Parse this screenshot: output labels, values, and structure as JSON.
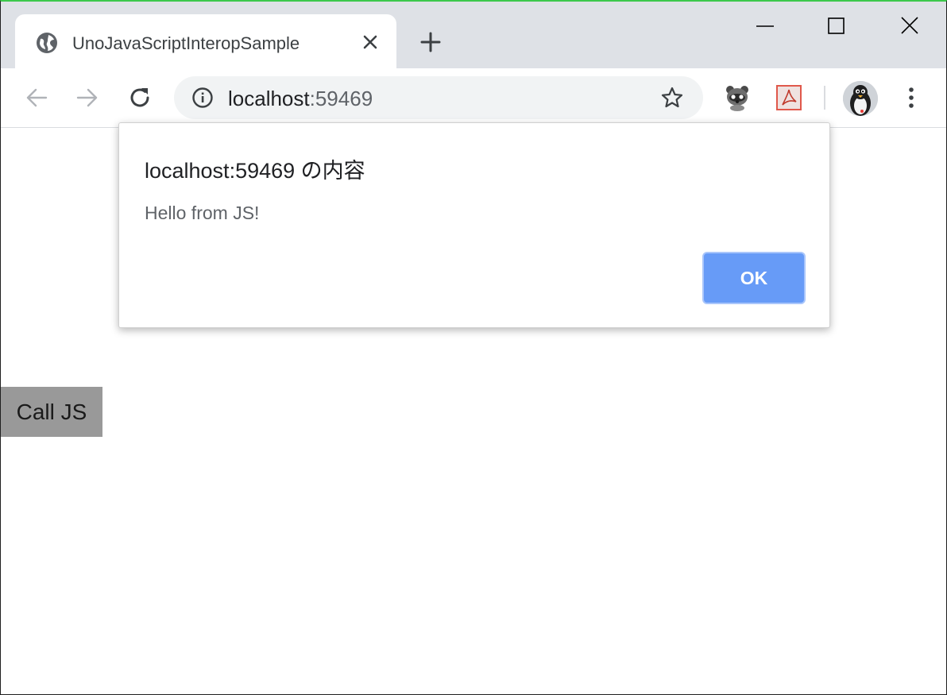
{
  "browser": {
    "tab": {
      "title": "UnoJavaScriptInteropSample",
      "favicon": "globe-icon"
    },
    "address_bar": {
      "host": "localhost",
      "port": ":59469"
    },
    "toolbar_icons": [
      "back-arrow-icon",
      "forward-arrow-icon",
      "reload-icon",
      "info-icon",
      "star-icon",
      "raccoon-extension-icon",
      "pdf-extension-icon",
      "profile-avatar",
      "more-menu-icon"
    ],
    "window_controls": [
      "minimize-icon",
      "maximize-icon",
      "close-icon"
    ]
  },
  "page": {
    "call_button_label": "Call JS"
  },
  "dialog": {
    "title": "localhost:59469 の内容",
    "message": "Hello from JS!",
    "ok_label": "OK"
  },
  "colors": {
    "tabstrip": "#dee1e6",
    "omnibox": "#f1f3f4",
    "ok_button": "#679bf7",
    "call_button": "#999999",
    "window_border_top": "#3cc84b"
  }
}
